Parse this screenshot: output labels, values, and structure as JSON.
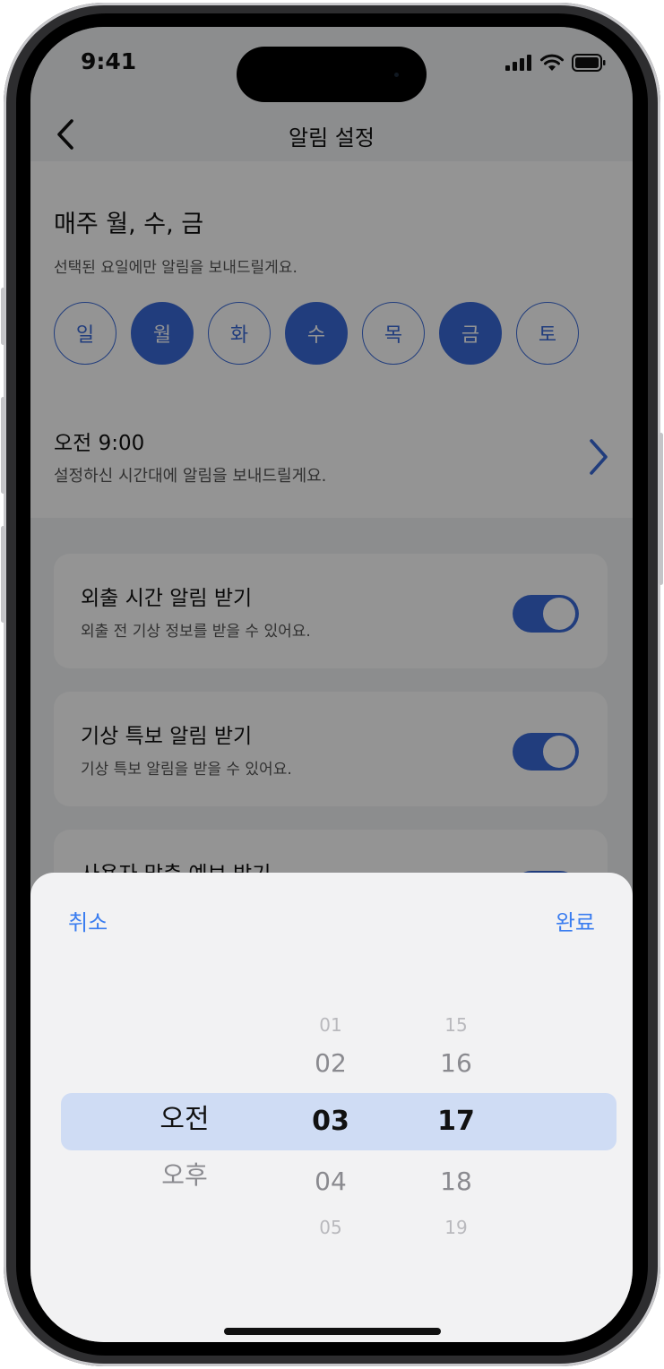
{
  "status": {
    "time": "9:41"
  },
  "nav": {
    "title": "알림 설정"
  },
  "days": {
    "title": "매주 월, 수, 금",
    "subtitle": "선택된 요일에만 알림을 보내드릴게요.",
    "items": [
      {
        "label": "일",
        "selected": false
      },
      {
        "label": "월",
        "selected": true
      },
      {
        "label": "화",
        "selected": false
      },
      {
        "label": "수",
        "selected": true
      },
      {
        "label": "목",
        "selected": false
      },
      {
        "label": "금",
        "selected": true
      },
      {
        "label": "토",
        "selected": false
      }
    ]
  },
  "time": {
    "title": "오전 9:00",
    "subtitle": "설정하신 시간대에 알림을 보내드릴게요."
  },
  "cards": [
    {
      "title": "외출 시간 알림 받기",
      "subtitle": "외출 전 기상 정보를 받을 수 있어요.",
      "on": true
    },
    {
      "title": "기상 특보 알림 받기",
      "subtitle": "기상 특보 알림을 받을 수 있어요.",
      "on": true
    },
    {
      "title": "사용자 맞춤 예보 받기",
      "subtitle": "",
      "on": true
    }
  ],
  "picker": {
    "cancel": "취소",
    "done": "완료",
    "ampm": [
      "오전",
      "오후"
    ],
    "hours": [
      "01",
      "02",
      "03",
      "04",
      "05"
    ],
    "minutes": [
      "15",
      "16",
      "17",
      "18",
      "19"
    ],
    "selected": {
      "ampm": "오전",
      "hour": "03",
      "minute": "17"
    }
  },
  "colors": {
    "accent": "#3a6ad8",
    "link": "#3a7df0",
    "highlight": "#cfdcf4"
  }
}
